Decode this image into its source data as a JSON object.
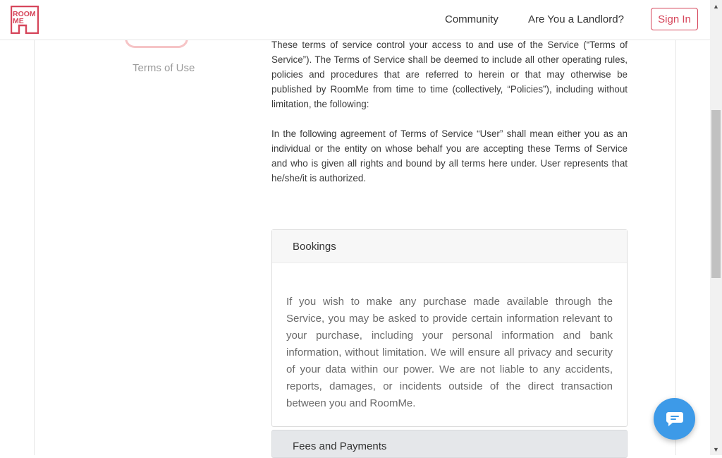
{
  "header": {
    "logo_text_line1": "ROOM",
    "logo_text_line2": "ME",
    "nav_community": "Community",
    "nav_landlord": "Are You a Landlord?",
    "signin_label": "Sign In"
  },
  "sidebar": {
    "tab_label": "Terms of Use"
  },
  "main": {
    "paragraph_1": "These terms of service control your access to and use of the Service (“Terms of Service”). The Terms of Service shall be deemed to include all other operating rules, policies and procedures that are referred to herein or that may otherwise be published by RoomMe from time to time (collectively, “Policies”), including without limitation, the following:",
    "paragraph_2": "In the following agreement of Terms of Service “User” shall mean either you as an individual or the entity on whose behalf you are accepting these Terms of Service and who is given all rights and bound by all terms here under. User represents that he/she/it is authorized."
  },
  "accordion": [
    {
      "title": "Bookings",
      "body": "If you wish to make any purchase made available through the Service, you may be asked to provide certain information relevant to your purchase, including your personal information and bank information, without limitation. We will ensure all privacy and security of your data within our power. We are not liable to any accidents, reports, damages, or incidents outside of the direct transaction between you and RoomMe."
    },
    {
      "title": "Fees and Payments"
    }
  ],
  "colors": {
    "brand": "#d6455a",
    "chat": "#3d9ae8"
  }
}
